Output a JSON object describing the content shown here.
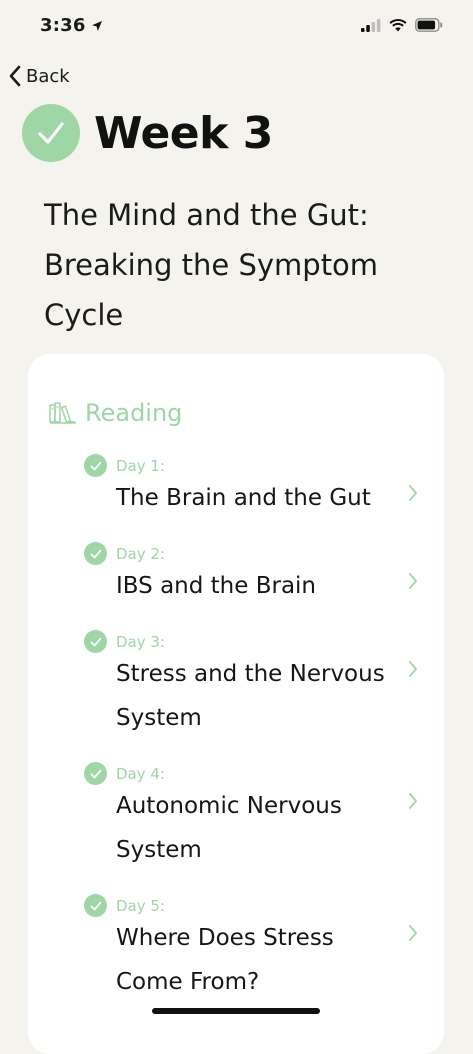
{
  "status_bar": {
    "time": "3:36"
  },
  "nav": {
    "back_label": "Back"
  },
  "week": {
    "title": "Week 3",
    "subtitle": "The Mind and the Gut: Breaking the Symptom Cycle"
  },
  "section": {
    "label": "Reading",
    "icon": "books-icon"
  },
  "lessons": [
    {
      "day": "Day 1:",
      "title": "The Brain and the Gut",
      "completed": true
    },
    {
      "day": "Day 2:",
      "title": "IBS and the Brain",
      "completed": true
    },
    {
      "day": "Day 3:",
      "title": "Stress and the Nervous System",
      "completed": true
    },
    {
      "day": "Day 4:",
      "title": "Autonomic Nervous System",
      "completed": true
    },
    {
      "day": "Day 5:",
      "title": "Where Does Stress Come From?",
      "completed": true
    }
  ],
  "colors": {
    "accent_green": "#9ed6a5",
    "background": "#f4f3ee",
    "card": "#ffffff"
  }
}
